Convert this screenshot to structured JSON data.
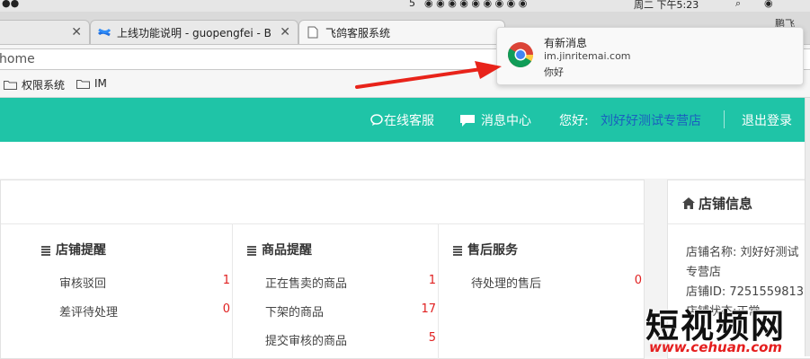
{
  "menubar": {
    "badge_count": "5",
    "clock": "周二 下午5:23"
  },
  "tabs": [
    {
      "title": "上线功能说明 - guopengfei - B",
      "icon": "confluence-icon"
    },
    {
      "title": "飞鸽客服系统",
      "icon": "page-icon"
    }
  ],
  "profile_name": "鹏飞",
  "address": {
    "url": "home"
  },
  "bookmarks": [
    {
      "label": "权限系统"
    },
    {
      "label": "IM"
    }
  ],
  "nav": {
    "online_service": "在线客服",
    "message_center": "消息中心",
    "greeting": "您好:",
    "shop_name": "刘好好测试专营店",
    "logout": "退出登录"
  },
  "columns": [
    {
      "title": "店铺提醒",
      "rows": [
        {
          "label": "审核驳回",
          "value": "1"
        },
        {
          "label": "差评待处理",
          "value": "0"
        }
      ]
    },
    {
      "title": "商品提醒",
      "rows": [
        {
          "label": "正在售卖的商品",
          "value": "1"
        },
        {
          "label": "下架的商品",
          "value": "17"
        },
        {
          "label": "提交审核的商品",
          "value": "5"
        }
      ]
    },
    {
      "title": "售后服务",
      "rows": [
        {
          "label": "待处理的售后",
          "value": "0"
        }
      ]
    }
  ],
  "shop_info": {
    "title": "店铺信息",
    "name_line": "店铺名称:  刘好好测试",
    "name_line2": "专营店",
    "id_line": "店铺ID:  7251559813",
    "cut_line": "店铺状态:正常"
  },
  "notification": {
    "title": "有新消息",
    "site": "im.jinritemai.com",
    "body": "你好"
  },
  "watermark": {
    "main": "短视频网",
    "url": "www.cehuan.com"
  },
  "colors": {
    "accent": "#1fc4a7",
    "value_red": "#e02020",
    "arrow_red": "#e8231a"
  }
}
